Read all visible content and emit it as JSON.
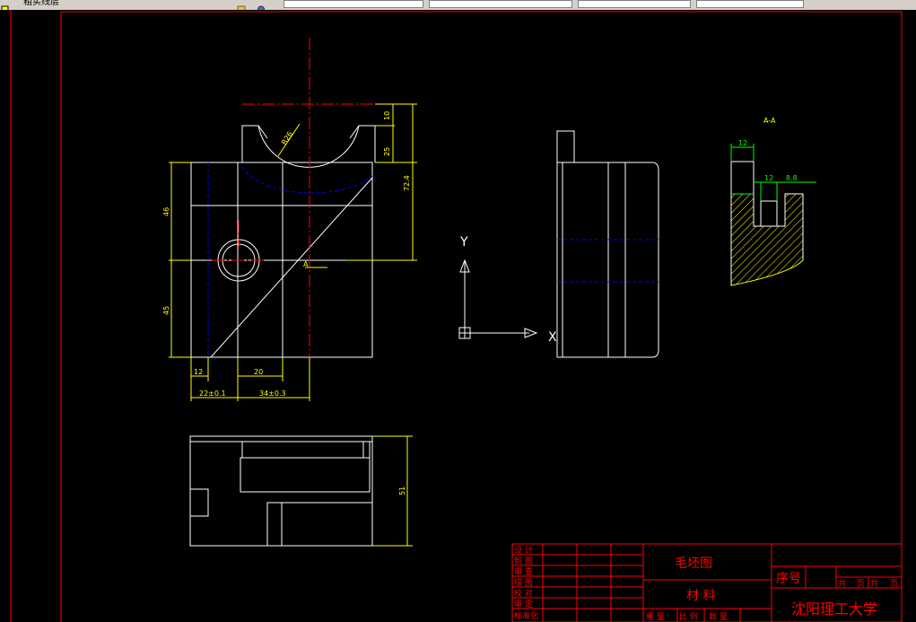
{
  "toolbar": {
    "layer_name": "粗实线层",
    "fields": [
      "",
      "",
      "",
      "",
      ""
    ]
  },
  "drawing": {
    "section_label": "A-A",
    "cut_mark": "A",
    "ucs": {
      "x_label": "X",
      "y_label": "Y"
    },
    "dims": {
      "radius": "R26",
      "d10": "10",
      "d25": "25",
      "d72": "72.4",
      "d46": "46",
      "d45": "45",
      "d12": "12",
      "d20": "20",
      "d22": "22±0.1",
      "d34": "34±0.3",
      "d51": "51",
      "sec12a": "12",
      "sec12b": "12",
      "sec88": "8.8"
    }
  },
  "title_block": {
    "title": "毛坯图",
    "material_label": "材  料",
    "seq_label": "序号",
    "school": "沈阳理工大学",
    "roles": [
      "设  计",
      "制  图",
      "审  查",
      "描  图",
      "校  对",
      "审  定",
      "标准化"
    ],
    "sheet": {
      "a": "共",
      "b": "页",
      "c": "共",
      "d": "页"
    },
    "bottom": {
      "weight": "重  量",
      "ratio": "比  例",
      "count": "数  量"
    }
  },
  "colors": {
    "background": "#000000",
    "outline": "#ffffff",
    "dimension": "#ffff00",
    "center": "#ff0000",
    "hidden": "#0000ff",
    "frame": "#ff0000",
    "hatch": "#ffff00",
    "section_dim": "#00ff00"
  }
}
